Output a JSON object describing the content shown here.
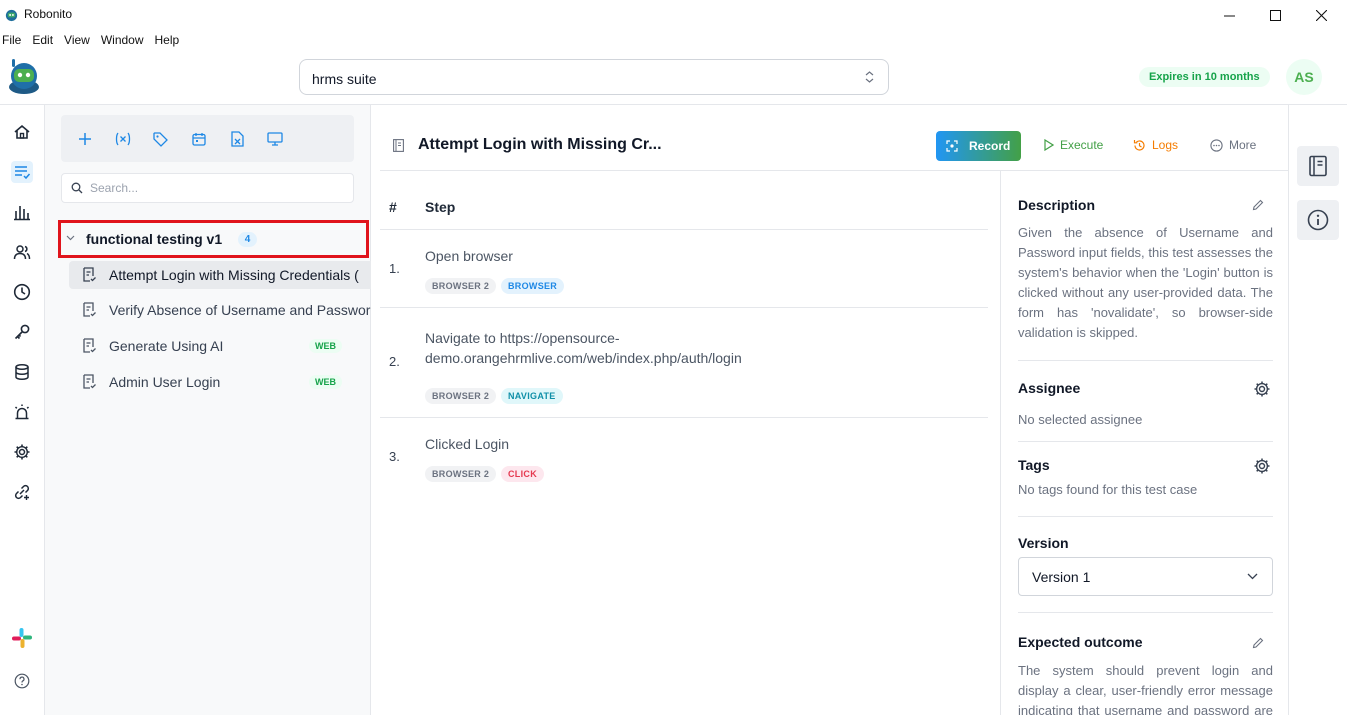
{
  "window": {
    "title": "Robonito"
  },
  "menu": [
    "File",
    "Edit",
    "View",
    "Window",
    "Help"
  ],
  "header": {
    "suite_value": "hrms suite",
    "expires_label": "Expires in 10 months",
    "avatar_initials": "AS"
  },
  "tree": {
    "search_placeholder": "Search...",
    "folder": {
      "name": "functional testing v1",
      "count": "4"
    },
    "test_cases": [
      {
        "label": "Attempt Login with Missing Credentials (",
        "badge": ""
      },
      {
        "label": "Verify Absence of Username and Password",
        "badge": ""
      },
      {
        "label": "Generate Using AI",
        "badge": "WEB"
      },
      {
        "label": "Admin User Login",
        "badge": "WEB"
      }
    ]
  },
  "main": {
    "title": "Attempt Login with Missing Cr...",
    "actions": {
      "record": "Record",
      "execute": "Execute",
      "logs": "Logs",
      "more": "More"
    },
    "columns": {
      "num": "#",
      "step": "Step"
    },
    "steps": [
      {
        "num": "1.",
        "text": "Open browser",
        "chips": [
          "BROWSER 2",
          "BROWSER"
        ]
      },
      {
        "num": "2.",
        "text": "Navigate to https://opensource-demo.orangehrmlive.com/web/index.php/auth/login",
        "chips": [
          "BROWSER 2",
          "NAVIGATE"
        ]
      },
      {
        "num": "3.",
        "text": "Clicked Login",
        "chips": [
          "BROWSER 2",
          "CLICK"
        ]
      }
    ]
  },
  "details": {
    "description_title": "Description",
    "description": "Given the absence of Username and Password input fields, this test assesses the system's behavior when the 'Login' button is clicked without any user-provided data. The form has 'novalidate', so browser-side validation is skipped.",
    "assignee_title": "Assignee",
    "assignee_value": "No selected assignee",
    "tags_title": "Tags",
    "tags_value": "No tags found for this test case",
    "version_title": "Version",
    "version_value": "Version 1",
    "outcome_title": "Expected outcome",
    "outcome": "The system should prevent login and display a clear, user-friendly error message indicating that username and password are required."
  },
  "colors": {
    "accent": "#1e88e5",
    "highlight_border": "#e0141c",
    "web_badge": "#16a34a"
  }
}
